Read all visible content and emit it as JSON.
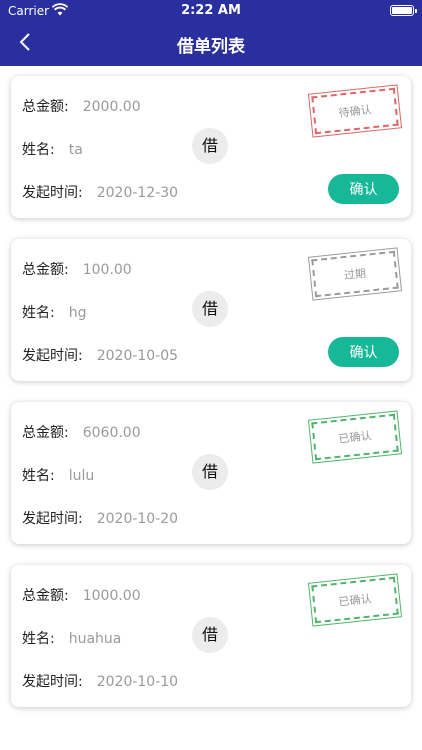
{
  "status": {
    "carrier": "Carrier",
    "time": "2:22 AM"
  },
  "nav": {
    "title": "借单列表",
    "back_icon": "chevron-left-icon"
  },
  "labels": {
    "amount": "总金额:",
    "name": "姓名:",
    "date": "发起时间:",
    "borrow": "借"
  },
  "colors": {
    "nav_bg": "#2a2fa0",
    "confirm_bg": "#17b897",
    "stamp_pending": "#d94c4c",
    "stamp_expired": "#8a8a8a",
    "stamp_confirmed": "#33a853"
  },
  "cards": [
    {
      "amount": "2000.00",
      "name": "ta",
      "date": "2020-12-30",
      "status": "待确认",
      "action": "确认"
    },
    {
      "amount": "100.00",
      "name": "hg",
      "date": "2020-10-05",
      "status": "过期",
      "action": "确认"
    },
    {
      "amount": "6060.00",
      "name": "lulu",
      "date": "2020-10-20",
      "status": "已确认"
    },
    {
      "amount": "1000.00",
      "name": "huahua",
      "date": "2020-10-10",
      "status": "已确认"
    }
  ]
}
